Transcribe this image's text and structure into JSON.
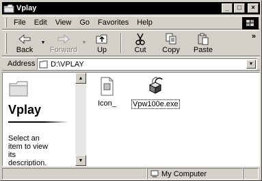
{
  "window": {
    "title": "Vplay",
    "minimize_label": "_",
    "maximize_label": "□",
    "close_label": "×"
  },
  "menu": {
    "items": [
      {
        "label": "File"
      },
      {
        "label": "Edit"
      },
      {
        "label": "View"
      },
      {
        "label": "Go"
      },
      {
        "label": "Favorites"
      },
      {
        "label": "Help"
      }
    ]
  },
  "toolbar": {
    "back": "Back",
    "forward": "Forward",
    "up": "Up",
    "cut": "Cut",
    "copy": "Copy",
    "paste": "Paste",
    "more": "»"
  },
  "address": {
    "label": "Address",
    "value": "D:\\VPLAY"
  },
  "leftpane": {
    "title": "Vplay",
    "description": "Select an item to view its description."
  },
  "files": [
    {
      "name": "Icon_",
      "icon": "document-icon"
    },
    {
      "name": "Vpw100e.exe",
      "icon": "setup-box-icon"
    }
  ],
  "status": {
    "location": "My Computer"
  }
}
